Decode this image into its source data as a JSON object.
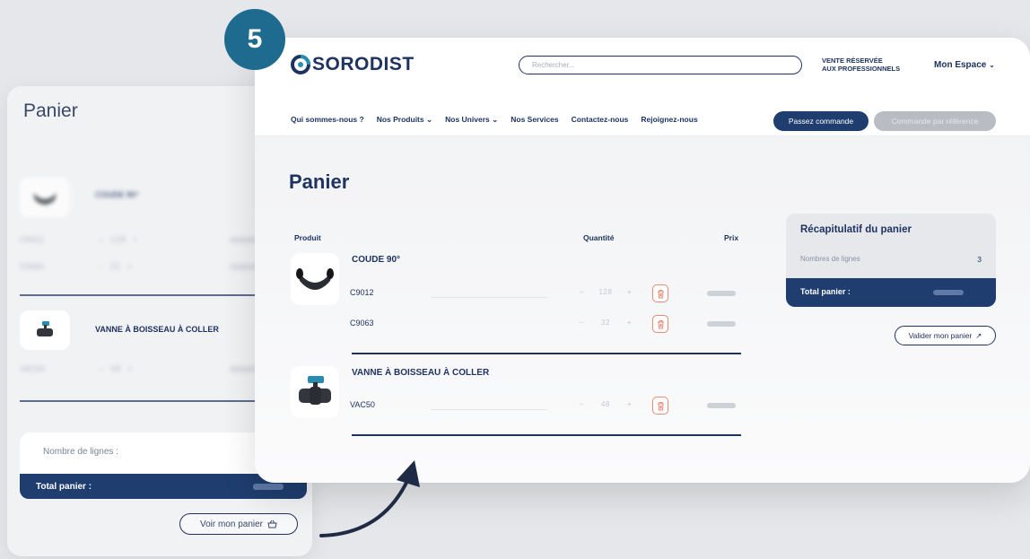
{
  "step": {
    "number": "5"
  },
  "mobile": {
    "title": "Panier",
    "items": [
      {
        "name": "COUDE 90°",
        "variants": [
          {
            "ref": "C9012",
            "qty": "128"
          },
          {
            "ref": "C9063",
            "qty": "32"
          }
        ]
      },
      {
        "name": "VANNE À BOISSEAU À COLLER",
        "variants": [
          {
            "ref": "VAC50",
            "qty": "48"
          }
        ]
      }
    ],
    "lines_label": "Nombre de lignes :",
    "total_label": "Total panier :",
    "cart_button": "Voir mon panier"
  },
  "desktop": {
    "logo": "SORODIST",
    "search_placeholder": "Rechercher...",
    "pro_notice_line1": "VENTE RÉSERVÉE",
    "pro_notice_line2": "AUX PROFESSIONNELS",
    "account": "Mon Espace",
    "nav": [
      "Qui sommes-nous ?",
      "Nos Produits",
      "Nos Univers",
      "Nos Services",
      "Contactez-nous",
      "Rejoignez-nous"
    ],
    "order_button": "Passez commande",
    "ref_order_button": "Commande par référence",
    "page_title": "Panier",
    "columns": {
      "product": "Produit",
      "quantity": "Quantité",
      "price": "Prix"
    },
    "products": [
      {
        "name": "COUDE 90°",
        "variants": [
          {
            "ref": "C9012",
            "qty": "128"
          },
          {
            "ref": "C9063",
            "qty": "32"
          }
        ]
      },
      {
        "name": "VANNE À BOISSEAU À COLLER",
        "variants": [
          {
            "ref": "VAC50",
            "qty": "48"
          }
        ]
      }
    ],
    "summary": {
      "title": "Récapitulatif du panier",
      "lines_label": "Nombres de lignes",
      "lines_count": "3",
      "total_label": "Total panier :"
    },
    "validate_button": "Valider mon panier"
  },
  "colors": {
    "navy": "#1f3d6f",
    "accent": "#2a8bb3",
    "badge": "#1f6b8f",
    "delete": "#e58b76"
  }
}
